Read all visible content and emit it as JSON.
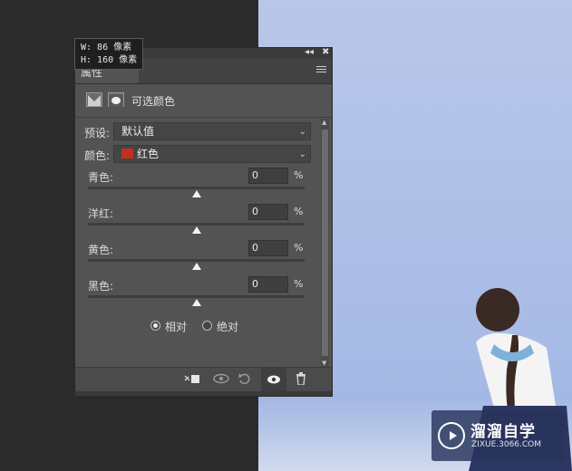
{
  "tooltip": {
    "w_line": "W:  86 像素",
    "h_line": "H: 160 像素"
  },
  "panel": {
    "title_controls": {
      "collapse": "◂◂",
      "close": "✖"
    },
    "tab_label": "属性",
    "header_title": "可选颜色",
    "preset": {
      "label": "预设:",
      "value": "默认值"
    },
    "colors": {
      "label": "颜色:",
      "value": "红色",
      "swatch": "#c0301f"
    },
    "sliders": [
      {
        "label": "青色:",
        "value": "0",
        "unit": "%",
        "level": 0.5
      },
      {
        "label": "洋红:",
        "value": "0",
        "unit": "%",
        "level": 0.5
      },
      {
        "label": "黄色:",
        "value": "0",
        "unit": "%",
        "level": 0.5
      },
      {
        "label": "黑色:",
        "value": "0",
        "unit": "%",
        "level": 0.5
      }
    ],
    "mode": {
      "relative": "相对",
      "absolute": "绝对",
      "selected": "relative"
    },
    "footer_icons": [
      "clip-to-layer-icon",
      "view-previous-icon",
      "reset-icon",
      "visibility-icon",
      "trash-icon"
    ]
  },
  "watermark": {
    "title": "溜溜自学",
    "subtitle": "ZIXUE.3066.COM"
  }
}
